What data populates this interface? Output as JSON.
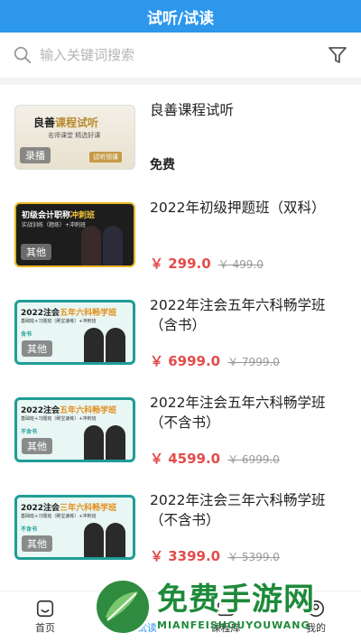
{
  "header": {
    "title": "试听/试读"
  },
  "search": {
    "placeholder": "输入关键词搜索"
  },
  "courses": [
    {
      "title": "良善课程试听",
      "price_label": "免费",
      "thumb": {
        "tag": "录播",
        "headline_a": "良善",
        "headline_b": "课程试听",
        "sub": "名师课堂  精选好课",
        "button": "试听领课"
      }
    },
    {
      "title": "2022年初级押题班（双科）",
      "price": "￥ 299.0",
      "original_price": "￥ 499.0",
      "thumb": {
        "tag": "其他",
        "headline_a": "初级会计职称",
        "headline_b": "冲刺班",
        "sub": "实战训练（题练）+冲刺班"
      }
    },
    {
      "title": "2022年注会五年六科畅学班（含书）",
      "price": "￥ 6999.0",
      "original_price": "￥ 7999.0",
      "thumb": {
        "tag": "其他",
        "headline_a": "2022注会",
        "headline_b": "五年六科畅学班",
        "sub": "基础班+习题班（刷宝速练）+冲刺班",
        "variant": "含书"
      }
    },
    {
      "title": "2022年注会五年六科畅学班（不含书）",
      "price": "￥ 4599.0",
      "original_price": "￥ 6999.0",
      "thumb": {
        "tag": "其他",
        "headline_a": "2022注会",
        "headline_b": "五年六科畅学班",
        "sub": "基础班+习题班（刷宝速练）+冲刺班",
        "variant": "不含书"
      }
    },
    {
      "title": "2022年注会三年六科畅学班（不含书）",
      "price": "￥ 3399.0",
      "original_price": "￥ 5399.0",
      "thumb": {
        "tag": "其他",
        "headline_a": "2022注会",
        "headline_b": "三年六科畅学班",
        "sub": "基础班+习题班（刷宝速练）+冲刺班",
        "variant": "不含书"
      }
    }
  ],
  "bottom_nav": [
    {
      "label": "首页",
      "icon": "home-icon"
    },
    {
      "label": "试听/试读",
      "icon": "book-icon",
      "active": true
    },
    {
      "label": "课程库",
      "icon": "library-icon"
    },
    {
      "label": "我的",
      "icon": "user-icon"
    }
  ],
  "watermark": {
    "text": "免费手游网",
    "sub": "MIANFEISHOUYOUWANG"
  },
  "colors": {
    "primary": "#2d97ec",
    "price": "#e34c4c",
    "watermark": "#1e8a3a"
  }
}
